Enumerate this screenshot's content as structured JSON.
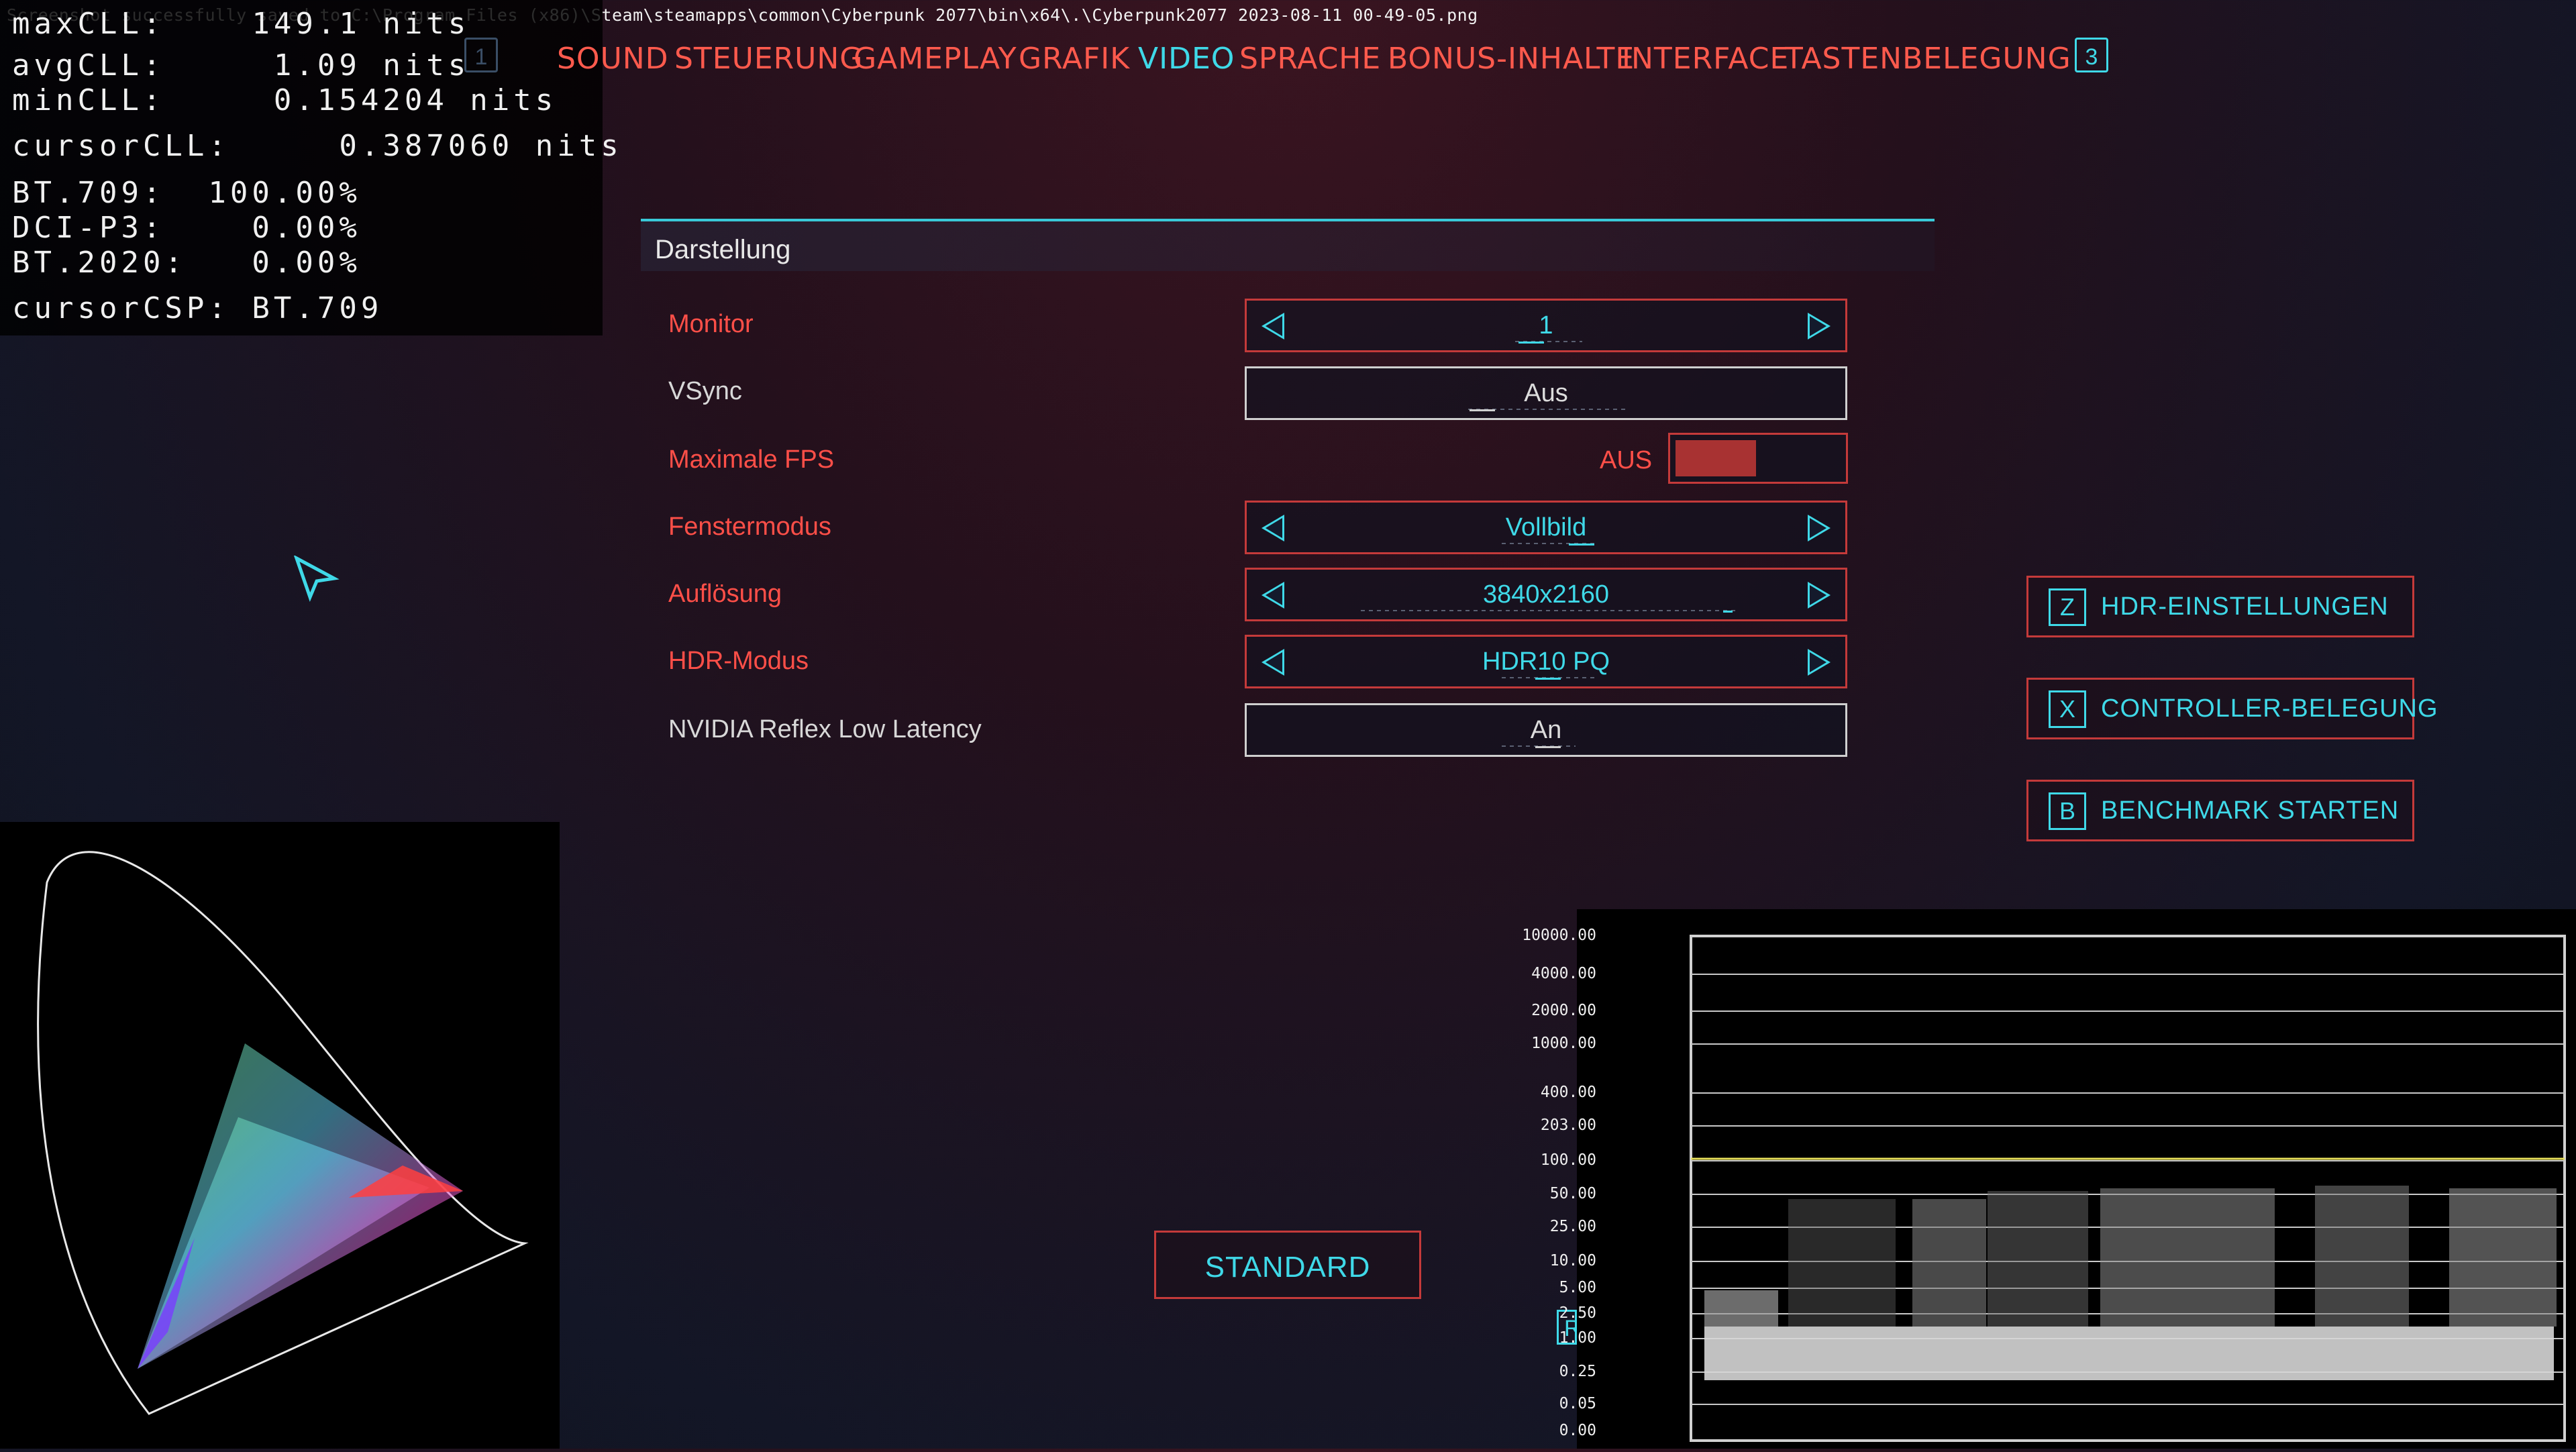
{
  "notice": "Screenshot successfully saved to C:\\Program Files (x86)\\Steam\\steamapps\\common\\Cyberpunk 2077\\bin\\x64\\.\\Cyberpunk2077 2023-08-11 00-49-05.png",
  "stats": {
    "max_cll": "maxCLL:    149.1 nits",
    "avg_cll": "avgCLL:     1.09 nits",
    "min_cll": "minCLL:     0.154204 nits",
    "cursor_cll": "cursorCLL:     0.387060 nits",
    "bt709": "BT.709:  100.00%",
    "dci_p3": "DCI-P3:    0.00%",
    "bt2020": "BT.2020:   0.00%",
    "cursor_csp": "cursorCSP: BT.709"
  },
  "nav": {
    "left_key": "1",
    "right_key": "3",
    "items": [
      {
        "label": "SOUND"
      },
      {
        "label": "STEUERUNG"
      },
      {
        "label": "GAMEPLAY"
      },
      {
        "label": "GRAFIK"
      },
      {
        "label": "VIDEO"
      },
      {
        "label": "SPRACHE"
      },
      {
        "label": "BONUS-INHALTE"
      },
      {
        "label": "INTERFACE"
      },
      {
        "label": "TASTENBELEGUNG"
      }
    ]
  },
  "section": {
    "title": "Darstellung"
  },
  "settings": [
    {
      "label": "Monitor",
      "value": "1"
    },
    {
      "label": "VSync",
      "value": "Aus"
    },
    {
      "label": "Maximale FPS",
      "value": "AUS",
      "on": false
    },
    {
      "label": "Fenstermodus",
      "value": "Vollbild"
    },
    {
      "label": "Auflösung",
      "value": "3840x2160"
    },
    {
      "label": "HDR-Modus",
      "value": "HDR10 PQ"
    },
    {
      "label": "NVIDIA Reflex Low Latency",
      "value": "An"
    }
  ],
  "side_buttons": [
    {
      "key": "Z",
      "label": "HDR-EINSTELLUNGEN"
    },
    {
      "key": "X",
      "label": "CONTROLLER-BELEGUNG"
    },
    {
      "key": "B",
      "label": "BENCHMARK STARTEN"
    }
  ],
  "standard_label": "STANDARD",
  "r_key": "R",
  "waveform": {
    "ticks": [
      "10000.00",
      "4000.00",
      "2000.00",
      "1000.00",
      "400.00",
      "203.00",
      "100.00",
      "50.00",
      "25.00",
      "10.00",
      "5.00",
      "2.50",
      "1.00",
      "0.25",
      "0.05",
      "0.00"
    ]
  },
  "colors": {
    "accent_red": "#ff5a4d",
    "accent_cyan": "#3fd9e8",
    "border_red": "#c43a3a"
  }
}
